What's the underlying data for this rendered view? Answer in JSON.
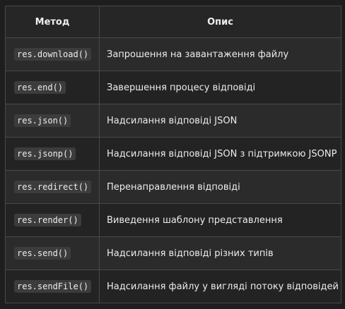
{
  "table": {
    "headers": {
      "method": "Метод",
      "description": "Опис"
    },
    "rows": [
      {
        "method": "res.download()",
        "description": "Запрошення на завантаження файлу"
      },
      {
        "method": "res.end()",
        "description": "Завершення процесу відповіді"
      },
      {
        "method": "res.json()",
        "description": "Надсилання відповіді JSON"
      },
      {
        "method": "res.jsonp()",
        "description": "Надсилання відповіді JSON з підтримкою JSONP"
      },
      {
        "method": "res.redirect()",
        "description": "Перенаправлення відповіді"
      },
      {
        "method": "res.render()",
        "description": "Виведення шаблону представлення"
      },
      {
        "method": "res.send()",
        "description": "Надсилання відповіді різних типів"
      },
      {
        "method": "res.sendFile()",
        "description": "Надсилання файлу у вигляді потоку відповідей"
      }
    ]
  }
}
